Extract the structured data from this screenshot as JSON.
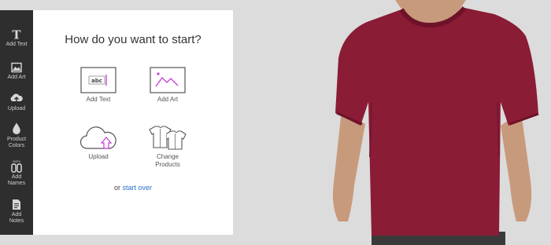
{
  "toolbar": {
    "items": [
      {
        "label": "Add Text",
        "icon": "text-icon"
      },
      {
        "label": "Add Art",
        "icon": "image-icon"
      },
      {
        "label": "Upload",
        "icon": "upload-cloud-icon"
      },
      {
        "label": "Product Colors",
        "icon": "drop-icon"
      },
      {
        "label": "Add Names",
        "icon": "names-icon"
      },
      {
        "label": "Add Notes",
        "icon": "notes-icon"
      }
    ]
  },
  "panel": {
    "heading": "How do you want to start?",
    "options": {
      "add_text": "Add Text",
      "add_text_sample": "abc",
      "add_art": "Add Art",
      "upload": "Upload",
      "change_products": "Change Products"
    },
    "start_over_prefix": "or",
    "start_over_link": "start over"
  },
  "product": {
    "name": "t-shirt",
    "color": "#8a1c35"
  },
  "colors": {
    "toolbar_bg": "#2e2e2e",
    "accent_link": "#2a6fc9",
    "accent_purple": "#c43ad6"
  }
}
